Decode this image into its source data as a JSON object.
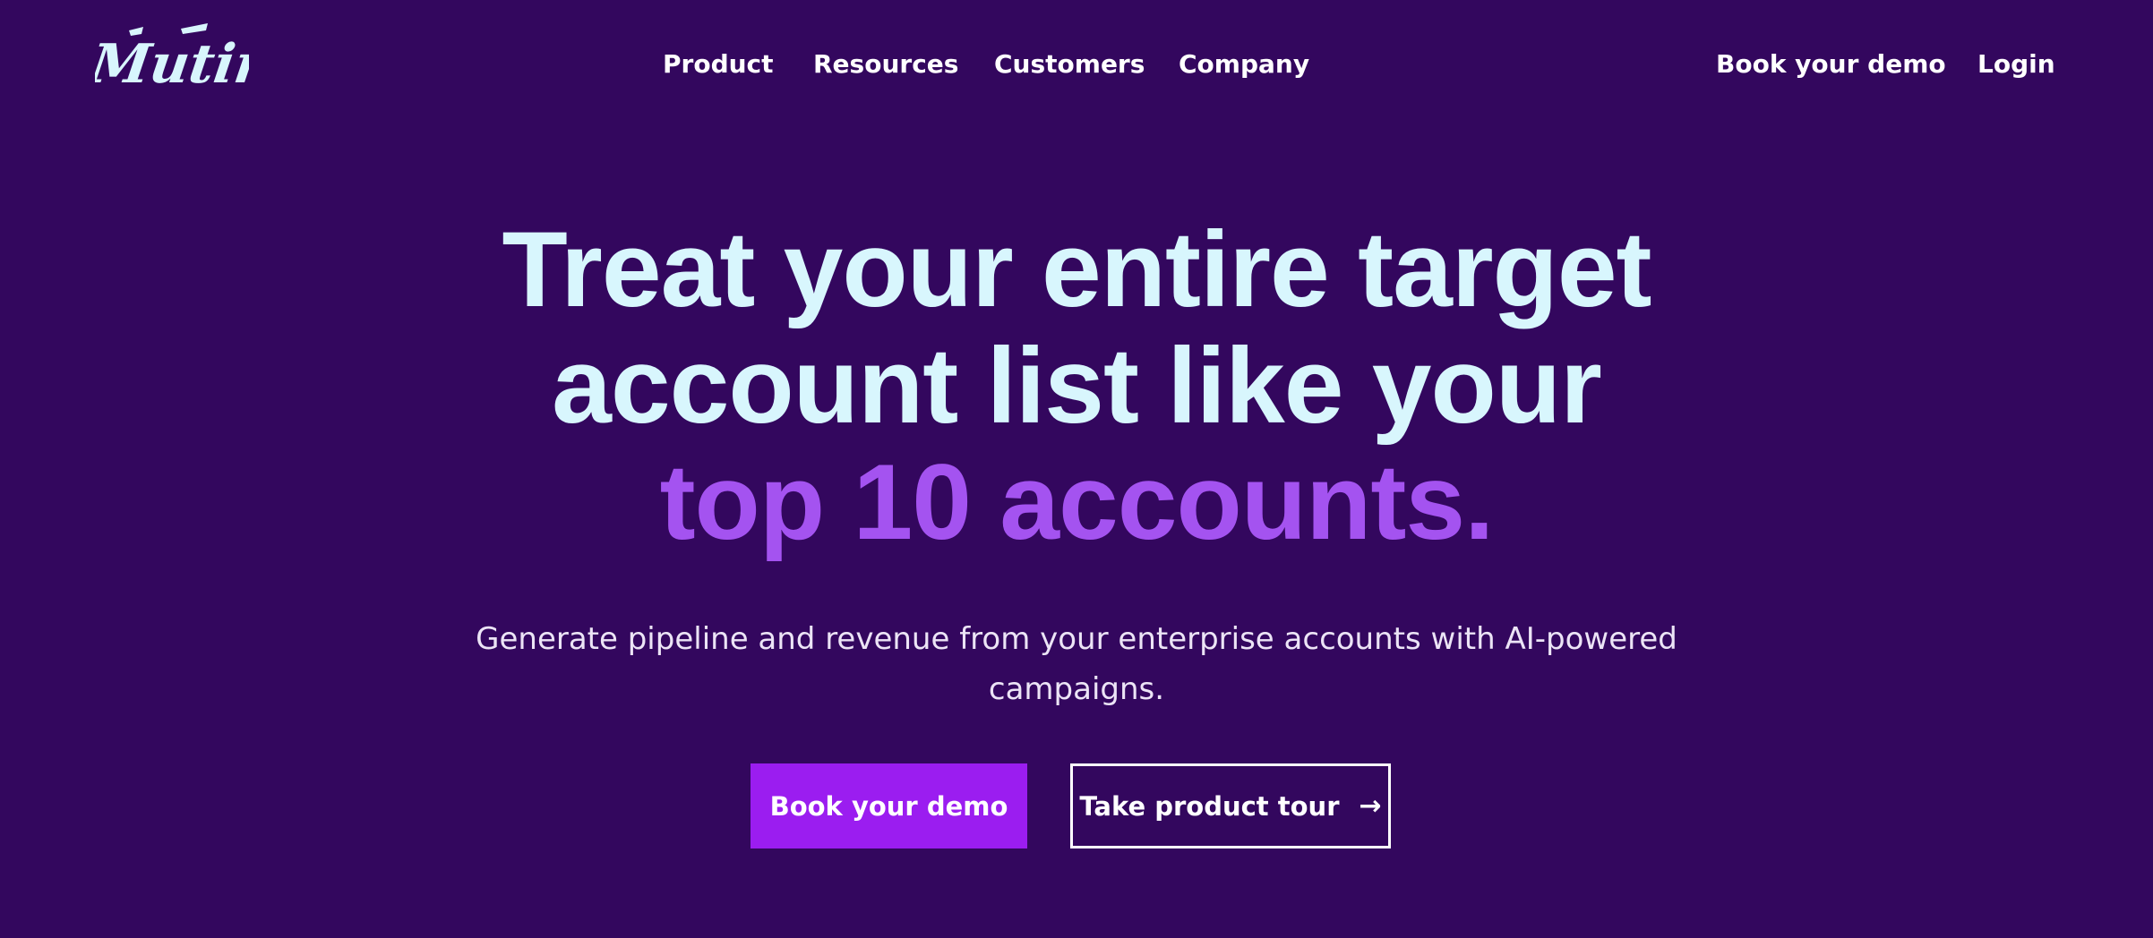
{
  "brand": {
    "logo_text": "Mutiny"
  },
  "nav": {
    "items": [
      {
        "label": "Product"
      },
      {
        "label": "Resources"
      },
      {
        "label": "Customers"
      },
      {
        "label": "Company"
      }
    ],
    "book_demo_label": "Book your demo",
    "login_label": "Login"
  },
  "hero": {
    "title_lines": [
      "Treat your entire target",
      "account list like your",
      "top 10 accounts."
    ],
    "subtitle": "Generate pipeline and revenue from your enterprise accounts with AI-powered campaigns.",
    "primary_cta": "Book your demo",
    "secondary_cta": "Take product tour",
    "secondary_cta_icon": "arrow-right-icon"
  },
  "colors": {
    "background": "#33075e",
    "headline": "#d8f6fd",
    "headline_accent": "#a453f0",
    "primary_button": "#9b1df0",
    "nav_text": "#ffffff"
  }
}
